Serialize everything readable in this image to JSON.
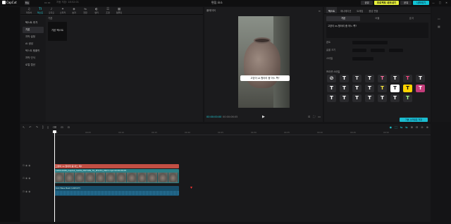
{
  "app": {
    "logo": "CapCut",
    "menu_label": "메뉴",
    "menu_text": "자동 저장: 18:52:01",
    "project_title": "편집 요소",
    "share": "공유",
    "pro": "프로젝트 내보내기",
    "export": "내보내기",
    "window_controls": [
      "—",
      "□",
      "✕"
    ]
  },
  "toptabs": [
    {
      "icon": "♫",
      "label": "미디어"
    },
    {
      "icon": "TI",
      "label": "텍스트"
    },
    {
      "icon": "♪",
      "label": "오디오"
    },
    {
      "icon": "✦",
      "label": "스티커"
    },
    {
      "icon": "◈",
      "label": "효과"
    },
    {
      "icon": "⇋",
      "label": "전환"
    },
    {
      "icon": "◐",
      "label": "필터"
    },
    {
      "icon": "☰",
      "label": "조정"
    },
    {
      "icon": "▦",
      "label": "템플릿"
    }
  ],
  "sidebar": {
    "items": [
      {
        "label": "텍스트 추가",
        "type": "hdr"
      },
      {
        "label": "기본",
        "type": "sel"
      },
      {
        "label": "자막 설정",
        "type": ""
      },
      {
        "label": "AI 생성",
        "type": ""
      },
      {
        "label": "텍스트 템플릿",
        "type": ""
      },
      {
        "label": "자막 인식",
        "type": ""
      },
      {
        "label": "로컬 캡션",
        "type": ""
      }
    ]
  },
  "content": {
    "section_label": "기본",
    "default_card": "기본 텍스트"
  },
  "player": {
    "title": "플레이어",
    "menu": "≡",
    "subtitle": "고양이 vs 항아리 중 어느 쪽?",
    "time_current": "00:00:00:00",
    "time_total": "00:00:06:05",
    "play_icon": "▶",
    "right_controls": [
      "⊡",
      "⛶",
      "▭"
    ]
  },
  "inspector": {
    "tabs": [
      "텍스트",
      "애니메이션",
      "트래킹",
      "음성 변환"
    ],
    "subtabs": [
      "기본",
      "버블",
      "효과"
    ],
    "text_value": "고양이 vs 항아리 중 어느 쪽?",
    "font_label": "폰트",
    "size_label": "글꼴 크기",
    "style_label": "스타일",
    "preset_label": "프리셋 스타일",
    "apply_button": "기본 스타일로 저장",
    "presets": [
      {
        "glyph": "⊘",
        "color": "#ffffff",
        "bg": "#2a2a2d"
      },
      {
        "glyph": "T",
        "color": "#ffffff",
        "bg": "#2a2a2d"
      },
      {
        "glyph": "T",
        "color": "#dddddd",
        "bg": "#2a2a2d"
      },
      {
        "glyph": "T",
        "color": "#ffffff",
        "bg": "#2a2a2d"
      },
      {
        "glyph": "T",
        "color": "#ff6fa0",
        "bg": "#2a2a2d"
      },
      {
        "glyph": "T",
        "color": "#ffffff",
        "bg": "#2a2a2d"
      },
      {
        "glyph": "T",
        "color": "#ff4b87",
        "bg": "#2a2a2d"
      },
      {
        "glyph": "T",
        "color": "#ffffff",
        "bg": "#2a2a2d"
      },
      {
        "glyph": "T",
        "color": "#ffffff",
        "bg": "#2a2a2d"
      },
      {
        "glyph": "T",
        "color": "#ffffff",
        "bg": "#2a2a2d"
      },
      {
        "glyph": "T",
        "color": "#ffffff",
        "bg": "#2a2a2d"
      },
      {
        "glyph": "T",
        "color": "#ffffff",
        "bg": "#2a2a2d"
      },
      {
        "glyph": "T",
        "color": "#ffeb3b",
        "bg": "#2a2a2d"
      },
      {
        "glyph": "T",
        "color": "#111111",
        "bg": "#ffffff"
      },
      {
        "glyph": "T",
        "color": "#111111",
        "bg": "#ffd400"
      },
      {
        "glyph": "T",
        "color": "#ffffff",
        "bg": "#c43c7a"
      },
      {
        "glyph": "T",
        "color": "#ffffff",
        "bg": "#2a2a2d"
      },
      {
        "glyph": "T",
        "color": "#ffffff",
        "bg": "#2a2a2d"
      },
      {
        "glyph": "T",
        "color": "#ffffff",
        "bg": "#2a2a2d"
      },
      {
        "glyph": "T",
        "color": "#ffffff",
        "bg": "#2a2a2d"
      },
      {
        "glyph": "T",
        "color": "#ffffff",
        "bg": "#2a2a2d"
      },
      {
        "glyph": "T",
        "color": "#ffffff",
        "bg": "#2a2a2d"
      },
      {
        "glyph": "T",
        "color": "#aaff88",
        "bg": "#2a2a2d"
      }
    ]
  },
  "timeline": {
    "tools": [
      "↖",
      "↶",
      "↷",
      "⫿",
      "⫾",
      "⌫",
      "⊟",
      "⊡"
    ],
    "right_tools": [
      "◉",
      "⬚",
      "⇆",
      "⇆",
      "⊞",
      "⊟",
      "⊖",
      "⊕"
    ],
    "ruler": [
      "00:00",
      "00:05",
      "00:10",
      "00:15",
      "00:20",
      "00:25",
      "00:30",
      "00:35",
      "00:40",
      "00:45",
      "00:50"
    ],
    "text_clip": "고양이 vs 항아리 중 어느 쪽?",
    "video_clip": "1200x1080_CapCut_SLOW_MOTION_TO_PHOTO_06d3.mp4  00:00:06:05",
    "audio_clip": "Kick Bass Beat (CAPCUT)",
    "track_text_icons": "⊡ ◉ ◉",
    "track_video_icons": "⊡ ◉ ◉",
    "track_audio_icons": "⊡ ◉ ◉",
    "cover_label": "커버"
  }
}
